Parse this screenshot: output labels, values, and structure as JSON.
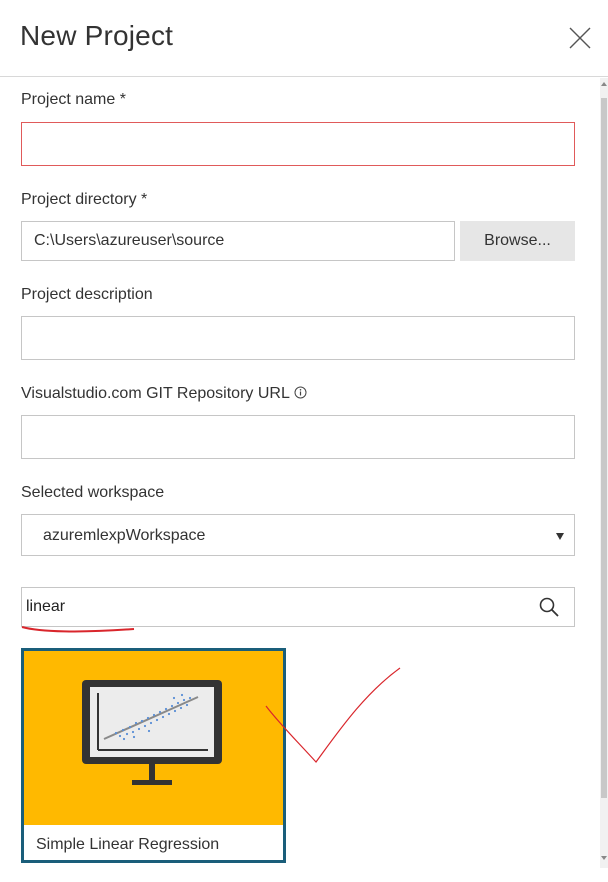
{
  "dialog": {
    "title": "New Project"
  },
  "form": {
    "project_name": {
      "label": "Project name *",
      "value": ""
    },
    "project_directory": {
      "label": "Project directory *",
      "value": "C:\\Users\\azureuser\\source",
      "browse_label": "Browse..."
    },
    "project_description": {
      "label": "Project description",
      "value": ""
    },
    "git_url": {
      "label": "Visualstudio.com GIT Repository URL",
      "value": ""
    },
    "workspace": {
      "label": "Selected workspace",
      "selected": "azuremlexpWorkspace"
    },
    "template_search": {
      "value": "linear"
    }
  },
  "templates": [
    {
      "name": "Simple Linear Regression",
      "tile_color": "#ffb900"
    }
  ],
  "colors": {
    "error_border": "#e05a5a",
    "selected_border": "#1a5e7a",
    "annotation": "#d9262c"
  }
}
